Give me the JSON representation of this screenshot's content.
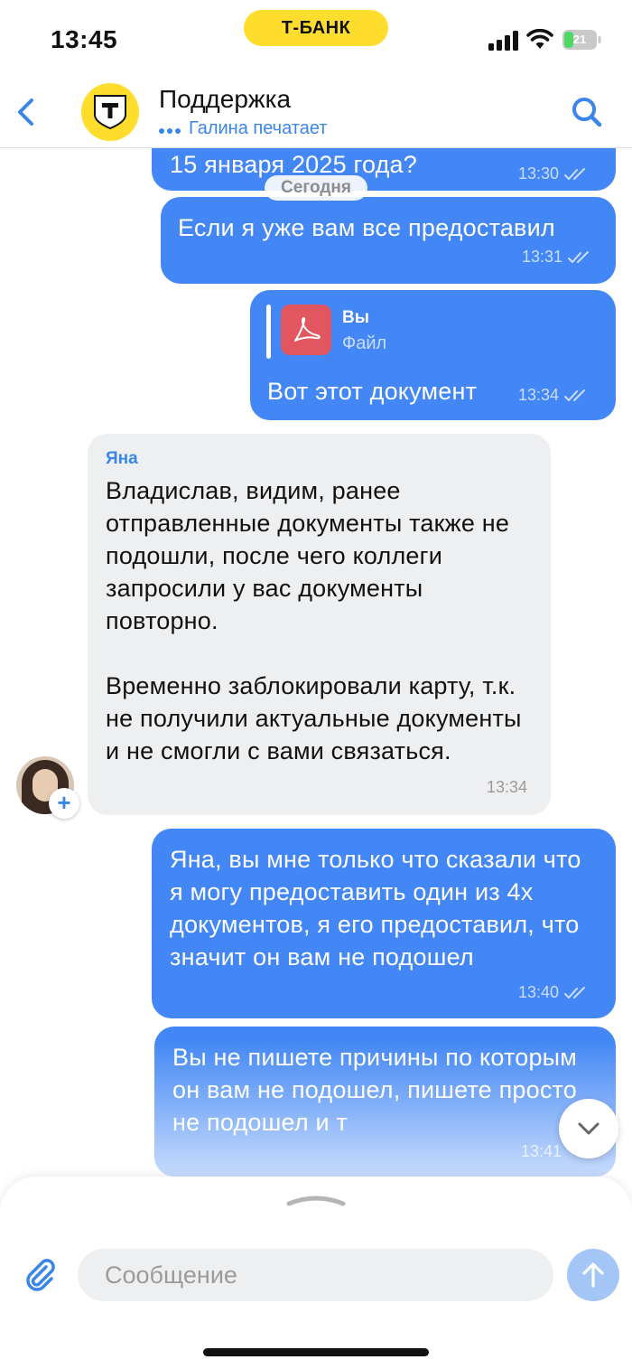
{
  "status_bar": {
    "time": "13:45",
    "bank_badge": "Т-БАНК",
    "battery": "21"
  },
  "header": {
    "title": "Поддержка",
    "typing": "Галина печатает",
    "brand_color": "#ffdd2d",
    "accent_color": "#3a86e8",
    "icons": {
      "back": "chevron-left-icon",
      "search": "search-icon",
      "logo": "tbank-logo-icon"
    }
  },
  "messages": {
    "date_separator": "Сегодня",
    "items": [
      {
        "direction": "out",
        "text": "15 января 2025 года?",
        "time": "13:30",
        "status": "read"
      },
      {
        "direction": "out",
        "text": "Если я уже вам все предоставил",
        "time": "13:31",
        "status": "read"
      },
      {
        "direction": "out",
        "reply_to": {
          "author": "Вы",
          "label": "Файл"
        },
        "text": "Вот этот документ",
        "time": "13:34",
        "status": "read"
      },
      {
        "direction": "in",
        "sender": "Яна",
        "paragraphs": [
          "Владислав, видим, ранее отправленные документы также не подошли, после чего коллеги запросили у вас документы повторно.",
          "Временно заблокировали карту, т.к. не получили актуальные документы и не смогли с вами связаться."
        ],
        "time": "13:34"
      },
      {
        "direction": "out",
        "text": "Яна, вы мне только что сказали что я могу предоставить один из 4х документов, я его предоставил, что значит он вам не подошел",
        "time": "13:40",
        "status": "read"
      },
      {
        "direction": "out",
        "text": "Вы не пишете причины по которым он вам не подошел, пишете просто не подошел и т",
        "time": "13:41",
        "status": "read"
      }
    ],
    "bubble_colors": {
      "outgoing": "#4287f5",
      "incoming": "#eeeff1"
    }
  },
  "composer": {
    "placeholder": "Сообщение"
  }
}
